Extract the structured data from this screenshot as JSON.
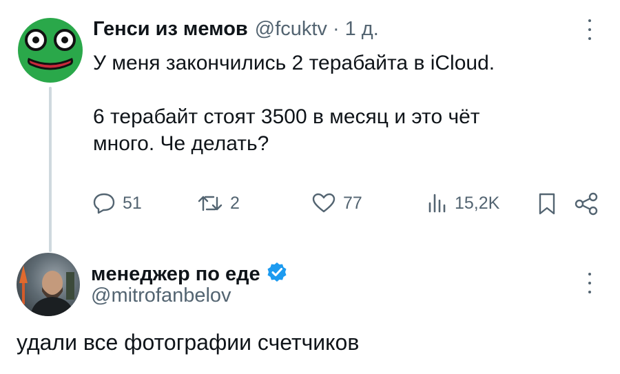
{
  "tweet": {
    "author_name": "Генси из мемов",
    "handle": "@fcuktv",
    "separator": "·",
    "time": "1 д.",
    "text": "У меня закончились 2 терабайта в iCloud.\n\n6 терабайт стоят 3500 в месяц и это чёт\nмного. Че делать?",
    "actions": {
      "reply_count": "51",
      "retweet_count": "2",
      "like_count": "77",
      "views_count": "15,2K"
    }
  },
  "reply": {
    "author_name": "менеджер по еде",
    "handle": "@mitrofanbelov",
    "text": "удали все фотографии счетчиков"
  },
  "icons": {
    "reply": "speech-bubble-icon",
    "retweet": "retweet-arrows-icon",
    "like": "heart-icon",
    "views": "bar-chart-icon",
    "bookmark": "bookmark-icon",
    "share": "share-nodes-icon",
    "more": "vertical-dots-icon",
    "verified": "verified-badge-icon"
  },
  "colors": {
    "text": "#0f1419",
    "secondary": "#536471",
    "verified_blue": "#1d9bf0",
    "avatar_green": "#2aa84a",
    "thread_line": "#cfd9de"
  }
}
